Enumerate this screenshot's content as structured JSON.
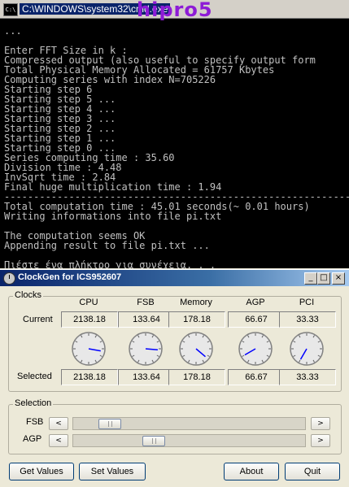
{
  "console": {
    "title": "C:\\WINDOWS\\system32\\cmd.exe",
    "overlay_text": "hipro5",
    "icon_label": "C:\\",
    "lines": [
      "...",
      "",
      "Enter FFT Size in k :",
      "Compressed output (also useful to specify output form",
      "Total Physical Memory Allocated = 61757 Kbytes",
      "Computing series with index N=705226",
      "Starting step 6",
      "Starting step 5 ...",
      "Starting step 4 ...",
      "Starting step 3 ...",
      "Starting step 2 ...",
      "Starting step 1 ...",
      "Starting step 0 ...",
      "Series computing time : 35.60",
      "Division time : 4.48",
      "InvSqrt time : 2.84",
      "Final huge multiplication time : 1.94",
      "------------------------------------------------------------",
      "Total computation time : 45.01 seconds(~ 0.01 hours)",
      "Writing informations into file pi.txt",
      "",
      "The computation seems OK",
      "Appending result to file pi.txt ...",
      "",
      "Πιέστε ένα πλήκτρο για συνέχεια. . ."
    ]
  },
  "clockgen": {
    "title": "ClockGen for ICS952607",
    "window_buttons": {
      "minimize": "_",
      "maximize": "□",
      "close": "×"
    },
    "clocks_label": "Clocks",
    "current_label": "Current",
    "selected_label": "Selected",
    "columns": [
      {
        "name": "CPU",
        "current": "2138.18",
        "selected": "2138.18",
        "needle_deg": 100
      },
      {
        "name": "FSB",
        "current": "133.64",
        "selected": "133.64",
        "needle_deg": 95
      },
      {
        "name": "Memory",
        "current": "178.18",
        "selected": "178.18",
        "needle_deg": 130
      },
      {
        "name": "AGP",
        "current": "66.67",
        "selected": "66.67",
        "needle_deg": 240
      },
      {
        "name": "PCI",
        "current": "33.33",
        "selected": "33.33",
        "needle_deg": 210
      }
    ],
    "selection_label": "Selection",
    "sliders": [
      {
        "label": "FSB",
        "position": 0.12
      },
      {
        "label": "AGP",
        "position": 0.33
      }
    ],
    "arrow_left": "<",
    "arrow_right": ">",
    "buttons": {
      "get_values": "Get Values",
      "set_values": "Set Values",
      "about": "About",
      "quit": "Quit"
    },
    "needle_color": "#0000ff"
  }
}
